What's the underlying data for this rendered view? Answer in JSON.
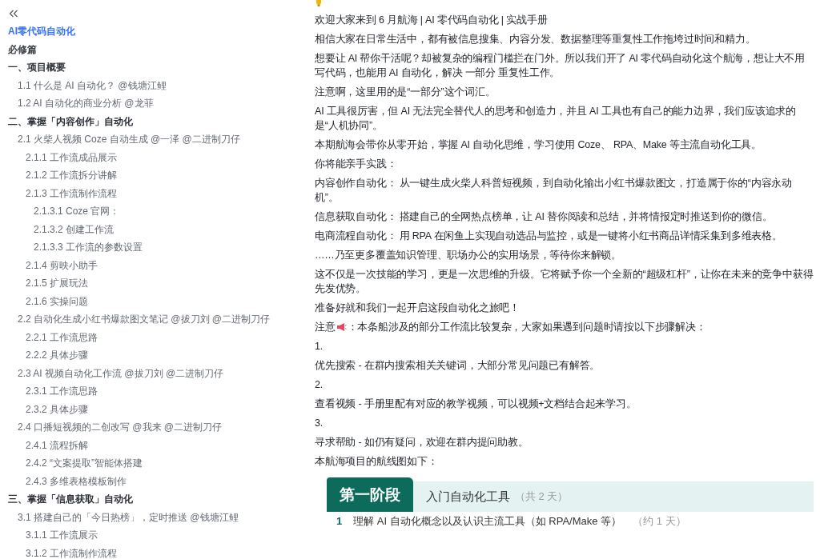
{
  "sidebar": {
    "title": "AI零代码自动化",
    "items": [
      {
        "kind": "part",
        "text": "必修篇"
      },
      {
        "kind": "section",
        "text": "一、项目概要",
        "children": [
          {
            "text": "1.1 什么是 AI 自动化？ @钱塘江鲤"
          },
          {
            "text": "1.2 AI 自动化的商业分析 @龙菲"
          }
        ]
      },
      {
        "kind": "section",
        "text": "二、掌握「内容创作」自动化",
        "children": [
          {
            "text": "2.1 火柴人视频 Coze 自动生成 @一泽 @二进制刀仔",
            "children": [
              {
                "text": "2.1.1 工作流成品展示"
              },
              {
                "text": "2.1.2 工作流拆分讲解"
              },
              {
                "text": "2.1.3 工作流制作流程",
                "children": [
                  {
                    "text": "2.1.3.1 Coze 官网："
                  },
                  {
                    "text": "2.1.3.2 创建工作流"
                  },
                  {
                    "text": "2.1.3.3 工作流的参数设置"
                  }
                ]
              },
              {
                "text": "2.1.4 剪映小助手"
              },
              {
                "text": "2.1.5 扩展玩法"
              },
              {
                "text": "2.1.6 实操问题"
              }
            ]
          },
          {
            "text": "2.2 自动化生成小红书爆款图文笔记 @拔刀刘 @二进制刀仔",
            "children": [
              {
                "text": "2.2.1 工作流思路"
              },
              {
                "text": "2.2.2 具体步骤"
              }
            ]
          },
          {
            "text": "2.3 AI 视频自动化工作流 @拔刀刘 @二进制刀仔",
            "children": [
              {
                "text": "2.3.1 工作流思路"
              },
              {
                "text": "2.3.2 具体步骤"
              }
            ]
          },
          {
            "text": "2.4 口播短视频的二创改写 @我来 @二进制刀仔",
            "children": [
              {
                "text": "2.4.1 流程拆解"
              },
              {
                "text": "2.4.2 “文案提取”智能体搭建"
              },
              {
                "text": "2.4.3 多维表格模板制作"
              }
            ]
          }
        ]
      },
      {
        "kind": "section",
        "text": "三、掌握「信息获取」自动化",
        "children": [
          {
            "text": "3.1 搭建自己的「今日热榜」，定时推送 @钱塘江鲤",
            "children": [
              {
                "text": "3.1.1 工作流展示"
              },
              {
                "text": "3.1.2 工作流制作流程"
              }
            ]
          }
        ]
      }
    ]
  },
  "content": {
    "blocks": [
      {
        "kind": "text",
        "text": "欢迎大家来到 6 月航海 | AI 零代码自动化 | 实战手册"
      },
      {
        "kind": "text",
        "text": "相信大家在日常生活中，都有被信息搜集、内容分发、数据整理等重复性工作拖垮过时间和精力。"
      },
      {
        "kind": "text",
        "text": "想要让 AI 帮你干活呢？却被复杂的编程门槛拦在门外。所以我们开了 AI 零代码自动化这个航海，想让大不用写代码，也能用 AI 自动化，解决 一部分 重复性工作。"
      },
      {
        "kind": "text",
        "text": "注意啊，这里用的是“一部分”这个词汇。"
      },
      {
        "kind": "text",
        "text": "AI 工具很厉害，但 AI 无法完全替代人的思考和创造力，并且 AI 工具也有自己的能力边界，我们应该追求的是“人机协同”。"
      },
      {
        "kind": "text",
        "text": "本期航海会带你从零开始，掌握 AI 自动化思维，学习使用 Coze、 RPA、Make 等主流自动化工具。"
      },
      {
        "kind": "text",
        "text": "你将能亲手实践："
      },
      {
        "kind": "text",
        "text": "内容创作自动化：  从一键生成火柴人科普短视频，到自动化输出小红书爆款图文，打造属于你的“内容永动机”。"
      },
      {
        "kind": "text",
        "text": "信息获取自动化：  搭建自己的全网热点榜单，让 AI 替你阅读和总结，并将情报定时推送到你的微信。"
      },
      {
        "kind": "text",
        "text": "电商流程自动化：  用 RPA 在闲鱼上实现自动选品与监控，或是一键将小红书商品详情采集到多维表格。"
      },
      {
        "kind": "text",
        "text": "……乃至更多覆盖知识管理、职场办公的实用场景，等待你来解锁。"
      },
      {
        "kind": "text",
        "text": "这不仅是一次技能的学习，更是一次思维的升级。它将赋予你一个全新的“超级杠杆”，让你在未来的竞争中获得先发优势。"
      },
      {
        "kind": "text",
        "text": "准备好就和我们一起开启这段自动化之旅吧！"
      },
      {
        "kind": "notice",
        "lead": "注意",
        "text": "：本条船涉及的部分工作流比较复杂，大家如果遇到问题时请按以下步骤解决："
      },
      {
        "kind": "text",
        "text": "1."
      },
      {
        "kind": "text",
        "text": "优先搜索 - 在群内搜索相关关键词，大部分常见问题已有解答。"
      },
      {
        "kind": "text",
        "text": "2."
      },
      {
        "kind": "text",
        "text": "查看视频 - 手册里配有对应的教学视频，可以视频+文档结合起来学习。"
      },
      {
        "kind": "text",
        "text": "3."
      },
      {
        "kind": "text",
        "text": "寻求帮助 - 如仍有疑问，欢迎在群内提问助教。"
      },
      {
        "kind": "text",
        "text": "本航海项目的航线图如下："
      }
    ],
    "roadmap": {
      "stage": "第一阶段",
      "title": "入门自动化工具",
      "duration": "（共 2 天）",
      "steps": [
        {
          "number": "1",
          "text": "理解 AI 自动化概念以及认识主流工具（如 RPA/Make 等）",
          "duration": "（约 1 天）"
        }
      ]
    }
  }
}
